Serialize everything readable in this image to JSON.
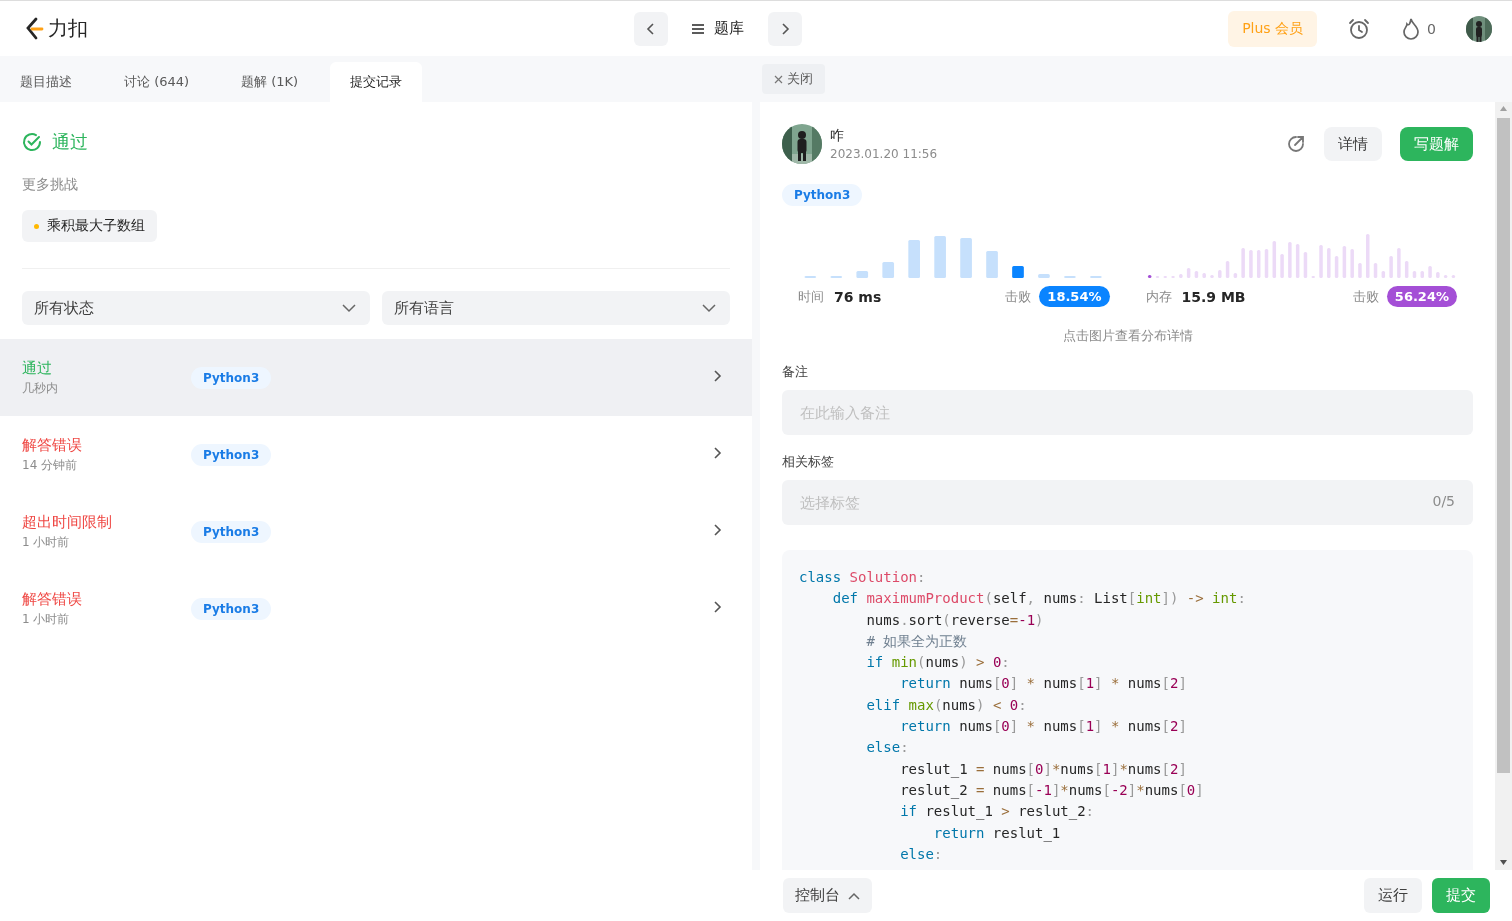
{
  "top_bar": {
    "logo": "力扣",
    "nav_title": "题库",
    "plus_button": "Plus 会员",
    "streak_count": "0"
  },
  "tabs": [
    {
      "label": "题目描述",
      "selected": false
    },
    {
      "label": "讨论 (644)",
      "selected": false
    },
    {
      "label": "题解 (1K)",
      "selected": false
    },
    {
      "label": "提交记录",
      "selected": true
    }
  ],
  "result": {
    "title": "通过",
    "more_label": "更多挑战",
    "challenge": "乘积最大子数组"
  },
  "filters": [
    {
      "value": "所有状态"
    },
    {
      "value": "所有语言"
    }
  ],
  "submissions": [
    {
      "status": "通过",
      "color": "#2db55d",
      "time": "几秒内",
      "language": "Python3",
      "selected": true
    },
    {
      "status": "解答错误",
      "color": "#ef4743",
      "time": "14 分钟前",
      "language": "Python3",
      "selected": false
    },
    {
      "status": "超出时间限制",
      "color": "#ef4743",
      "time": "1 小时前",
      "language": "Python3",
      "selected": false
    },
    {
      "status": "解答错误",
      "color": "#ef4743",
      "time": "1 小时前",
      "language": "Python3",
      "selected": false
    }
  ],
  "close_tab": "关闭",
  "detail": {
    "user": "咋",
    "date": "2023.01.20 11:56",
    "details_button": "详情",
    "write_button": "写题解",
    "language": "Python3",
    "stats": [
      {
        "kind": "runtime",
        "label": "时间",
        "value": "76 ms",
        "beat_label": "击败",
        "beat": "18.54%"
      },
      {
        "kind": "memory",
        "label": "内存",
        "value": "15.9 MB",
        "beat_label": "击败",
        "beat": "56.24%"
      }
    ],
    "chart_hint": "点击图片查看分布详情",
    "note": {
      "label": "备注",
      "placeholder": "在此输入备注"
    },
    "tags": {
      "label": "相关标签",
      "placeholder": "选择标签",
      "count": "0/5"
    },
    "code": [
      {
        "tokens": [
          {
            "kind": "keyword",
            "text": "class"
          },
          {
            "kind": "function",
            "text": " Solution"
          },
          {
            "kind": "punct",
            "text": ":"
          }
        ]
      },
      {
        "tokens": [
          {
            "kind": "keyword",
            "text": "    def"
          },
          {
            "kind": "function",
            "text": " maximumProduct"
          },
          {
            "kind": "punct",
            "text": "("
          },
          {
            "kind": "plain",
            "text": "self"
          },
          {
            "kind": "punct",
            "text": ","
          },
          {
            "kind": "plain",
            "text": " nums"
          },
          {
            "kind": "punct",
            "text": ":"
          },
          {
            "kind": "plain",
            "text": " List"
          },
          {
            "kind": "punct",
            "text": "["
          },
          {
            "kind": "builtin",
            "text": "int"
          },
          {
            "kind": "punct",
            "text": "])"
          },
          {
            "kind": "operator",
            "text": " ->"
          },
          {
            "kind": "builtin",
            "text": " int"
          },
          {
            "kind": "punct",
            "text": ":"
          }
        ]
      },
      {
        "tokens": [
          {
            "kind": "plain",
            "text": "        nums"
          },
          {
            "kind": "punct",
            "text": "."
          },
          {
            "kind": "plain",
            "text": "sort"
          },
          {
            "kind": "punct",
            "text": "("
          },
          {
            "kind": "plain",
            "text": "reverse"
          },
          {
            "kind": "operator",
            "text": "="
          },
          {
            "kind": "number",
            "text": "-1"
          },
          {
            "kind": "punct",
            "text": ")"
          }
        ]
      },
      {
        "tokens": [
          {
            "kind": "comment",
            "text": "        # 如果全为正数"
          }
        ]
      },
      {
        "tokens": [
          {
            "kind": "keyword",
            "text": "        if"
          },
          {
            "kind": "builtin",
            "text": " min"
          },
          {
            "kind": "punct",
            "text": "("
          },
          {
            "kind": "plain",
            "text": "nums"
          },
          {
            "kind": "punct",
            "text": ")"
          },
          {
            "kind": "operator",
            "text": " >"
          },
          {
            "kind": "number",
            "text": " 0"
          },
          {
            "kind": "punct",
            "text": ":"
          }
        ]
      },
      {
        "tokens": [
          {
            "kind": "keyword",
            "text": "            return"
          },
          {
            "kind": "plain",
            "text": " nums"
          },
          {
            "kind": "punct",
            "text": "["
          },
          {
            "kind": "number",
            "text": "0"
          },
          {
            "kind": "punct",
            "text": "]"
          },
          {
            "kind": "operator",
            "text": " *"
          },
          {
            "kind": "plain",
            "text": " nums"
          },
          {
            "kind": "punct",
            "text": "["
          },
          {
            "kind": "number",
            "text": "1"
          },
          {
            "kind": "punct",
            "text": "]"
          },
          {
            "kind": "operator",
            "text": " *"
          },
          {
            "kind": "plain",
            "text": " nums"
          },
          {
            "kind": "punct",
            "text": "["
          },
          {
            "kind": "number",
            "text": "2"
          },
          {
            "kind": "punct",
            "text": "]"
          }
        ]
      },
      {
        "tokens": [
          {
            "kind": "keyword",
            "text": "        elif"
          },
          {
            "kind": "builtin",
            "text": " max"
          },
          {
            "kind": "punct",
            "text": "("
          },
          {
            "kind": "plain",
            "text": "nums"
          },
          {
            "kind": "punct",
            "text": ")"
          },
          {
            "kind": "operator",
            "text": " <"
          },
          {
            "kind": "number",
            "text": " 0"
          },
          {
            "kind": "punct",
            "text": ":"
          }
        ]
      },
      {
        "tokens": [
          {
            "kind": "keyword",
            "text": "            return"
          },
          {
            "kind": "plain",
            "text": " nums"
          },
          {
            "kind": "punct",
            "text": "["
          },
          {
            "kind": "number",
            "text": "0"
          },
          {
            "kind": "punct",
            "text": "]"
          },
          {
            "kind": "operator",
            "text": " *"
          },
          {
            "kind": "plain",
            "text": " nums"
          },
          {
            "kind": "punct",
            "text": "["
          },
          {
            "kind": "number",
            "text": "1"
          },
          {
            "kind": "punct",
            "text": "]"
          },
          {
            "kind": "operator",
            "text": " *"
          },
          {
            "kind": "plain",
            "text": " nums"
          },
          {
            "kind": "punct",
            "text": "["
          },
          {
            "kind": "number",
            "text": "2"
          },
          {
            "kind": "punct",
            "text": "]"
          }
        ]
      },
      {
        "tokens": [
          {
            "kind": "keyword",
            "text": "        else"
          },
          {
            "kind": "punct",
            "text": ":"
          }
        ]
      },
      {
        "tokens": [
          {
            "kind": "plain",
            "text": "            reslut_1"
          },
          {
            "kind": "operator",
            "text": " ="
          },
          {
            "kind": "plain",
            "text": " nums"
          },
          {
            "kind": "punct",
            "text": "["
          },
          {
            "kind": "number",
            "text": "0"
          },
          {
            "kind": "punct",
            "text": "]"
          },
          {
            "kind": "operator",
            "text": "*"
          },
          {
            "kind": "plain",
            "text": "nums"
          },
          {
            "kind": "punct",
            "text": "["
          },
          {
            "kind": "number",
            "text": "1"
          },
          {
            "kind": "punct",
            "text": "]"
          },
          {
            "kind": "operator",
            "text": "*"
          },
          {
            "kind": "plain",
            "text": "nums"
          },
          {
            "kind": "punct",
            "text": "["
          },
          {
            "kind": "number",
            "text": "2"
          },
          {
            "kind": "punct",
            "text": "]"
          }
        ]
      },
      {
        "tokens": [
          {
            "kind": "plain",
            "text": "            reslut_2"
          },
          {
            "kind": "operator",
            "text": " ="
          },
          {
            "kind": "plain",
            "text": " nums"
          },
          {
            "kind": "punct",
            "text": "["
          },
          {
            "kind": "number",
            "text": "-1"
          },
          {
            "kind": "punct",
            "text": "]"
          },
          {
            "kind": "operator",
            "text": "*"
          },
          {
            "kind": "plain",
            "text": "nums"
          },
          {
            "kind": "punct",
            "text": "["
          },
          {
            "kind": "number",
            "text": "-2"
          },
          {
            "kind": "punct",
            "text": "]"
          },
          {
            "kind": "operator",
            "text": "*"
          },
          {
            "kind": "plain",
            "text": "nums"
          },
          {
            "kind": "punct",
            "text": "["
          },
          {
            "kind": "number",
            "text": "0"
          },
          {
            "kind": "punct",
            "text": "]"
          }
        ]
      },
      {
        "tokens": [
          {
            "kind": "keyword",
            "text": "            if"
          },
          {
            "kind": "plain",
            "text": " reslut_1"
          },
          {
            "kind": "operator",
            "text": " >"
          },
          {
            "kind": "plain",
            "text": " reslut_2"
          },
          {
            "kind": "punct",
            "text": ":"
          }
        ]
      },
      {
        "tokens": [
          {
            "kind": "keyword",
            "text": "                return"
          },
          {
            "kind": "plain",
            "text": " reslut_1"
          }
        ]
      },
      {
        "tokens": [
          {
            "kind": "keyword",
            "text": "            else"
          },
          {
            "kind": "punct",
            "text": ":"
          }
        ]
      }
    ]
  },
  "bottom_bar": {
    "console": "控制台",
    "run": "运行",
    "submit": "提交"
  }
}
